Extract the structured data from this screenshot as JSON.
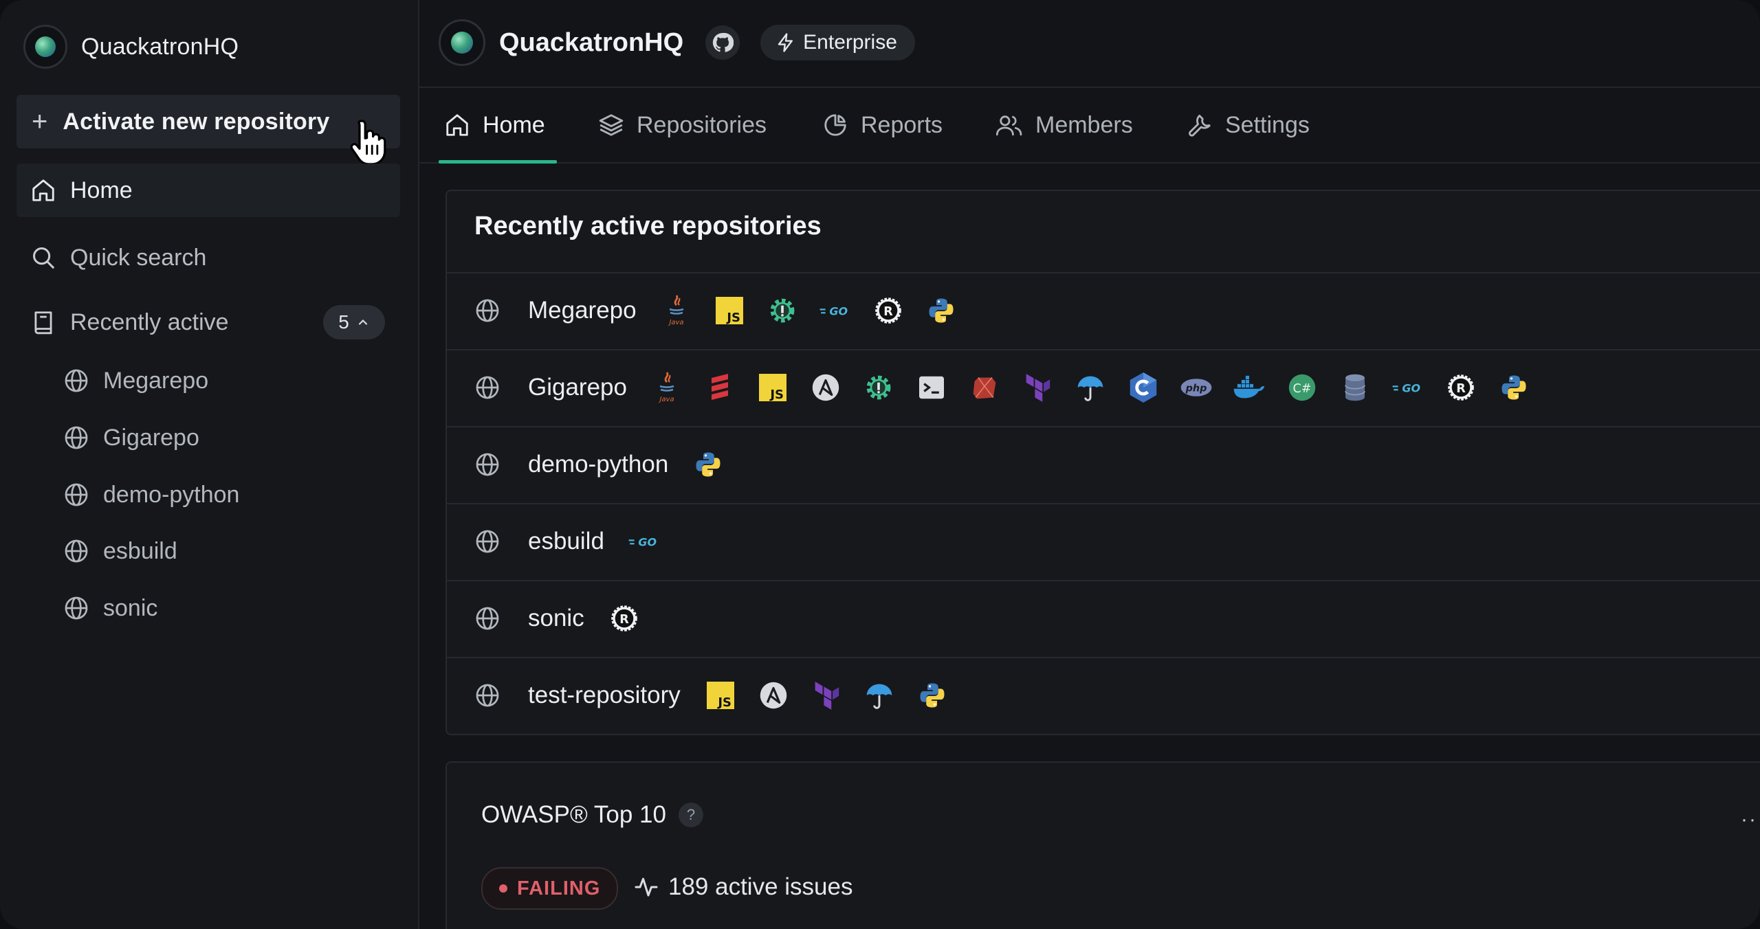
{
  "sidebar": {
    "org_name": "QuackatronHQ",
    "activate_label": "Activate new repository",
    "home_label": "Home",
    "search_label": "Quick search",
    "recent_label": "Recently active",
    "recent_count": "5",
    "recent_repos": [
      "Megarepo",
      "Gigarepo",
      "demo-python",
      "esbuild",
      "sonic"
    ]
  },
  "header": {
    "org_name": "QuackatronHQ",
    "plan_label": "Enterprise"
  },
  "tabs": [
    {
      "label": "Home",
      "icon": "home-icon",
      "active": true
    },
    {
      "label": "Repositories",
      "icon": "layers-icon",
      "active": false
    },
    {
      "label": "Reports",
      "icon": "pie-chart-icon",
      "active": false
    },
    {
      "label": "Members",
      "icon": "users-icon",
      "active": false
    },
    {
      "label": "Settings",
      "icon": "wrench-icon",
      "active": false
    }
  ],
  "recent_card": {
    "title": "Recently active repositories",
    "repos": [
      {
        "name": "Megarepo",
        "languages": [
          "java",
          "javascript",
          "secrets",
          "go",
          "rust",
          "python"
        ]
      },
      {
        "name": "Gigarepo",
        "languages": [
          "java",
          "scala",
          "javascript",
          "ansible",
          "secrets",
          "shell",
          "ruby",
          "terraform",
          "coverage",
          "cxx",
          "php",
          "docker",
          "csharp",
          "sql",
          "go",
          "rust",
          "python"
        ]
      },
      {
        "name": "demo-python",
        "languages": [
          "python"
        ]
      },
      {
        "name": "esbuild",
        "languages": [
          "go"
        ]
      },
      {
        "name": "sonic",
        "languages": [
          "rust"
        ]
      },
      {
        "name": "test-repository",
        "languages": [
          "javascript",
          "ansible",
          "terraform",
          "coverage",
          "python"
        ]
      }
    ]
  },
  "owasp_card": {
    "title": "OWASP® Top 10",
    "help": "?",
    "status": "FAILING",
    "issues": "189 active issues",
    "more": "··"
  },
  "colors": {
    "accent": "#2bb58a",
    "failing": "#e0606b",
    "js": "#f0d43a",
    "terraform": "#7b42bc",
    "python_blue": "#3d7ab8",
    "python_yellow": "#f6d24a"
  }
}
